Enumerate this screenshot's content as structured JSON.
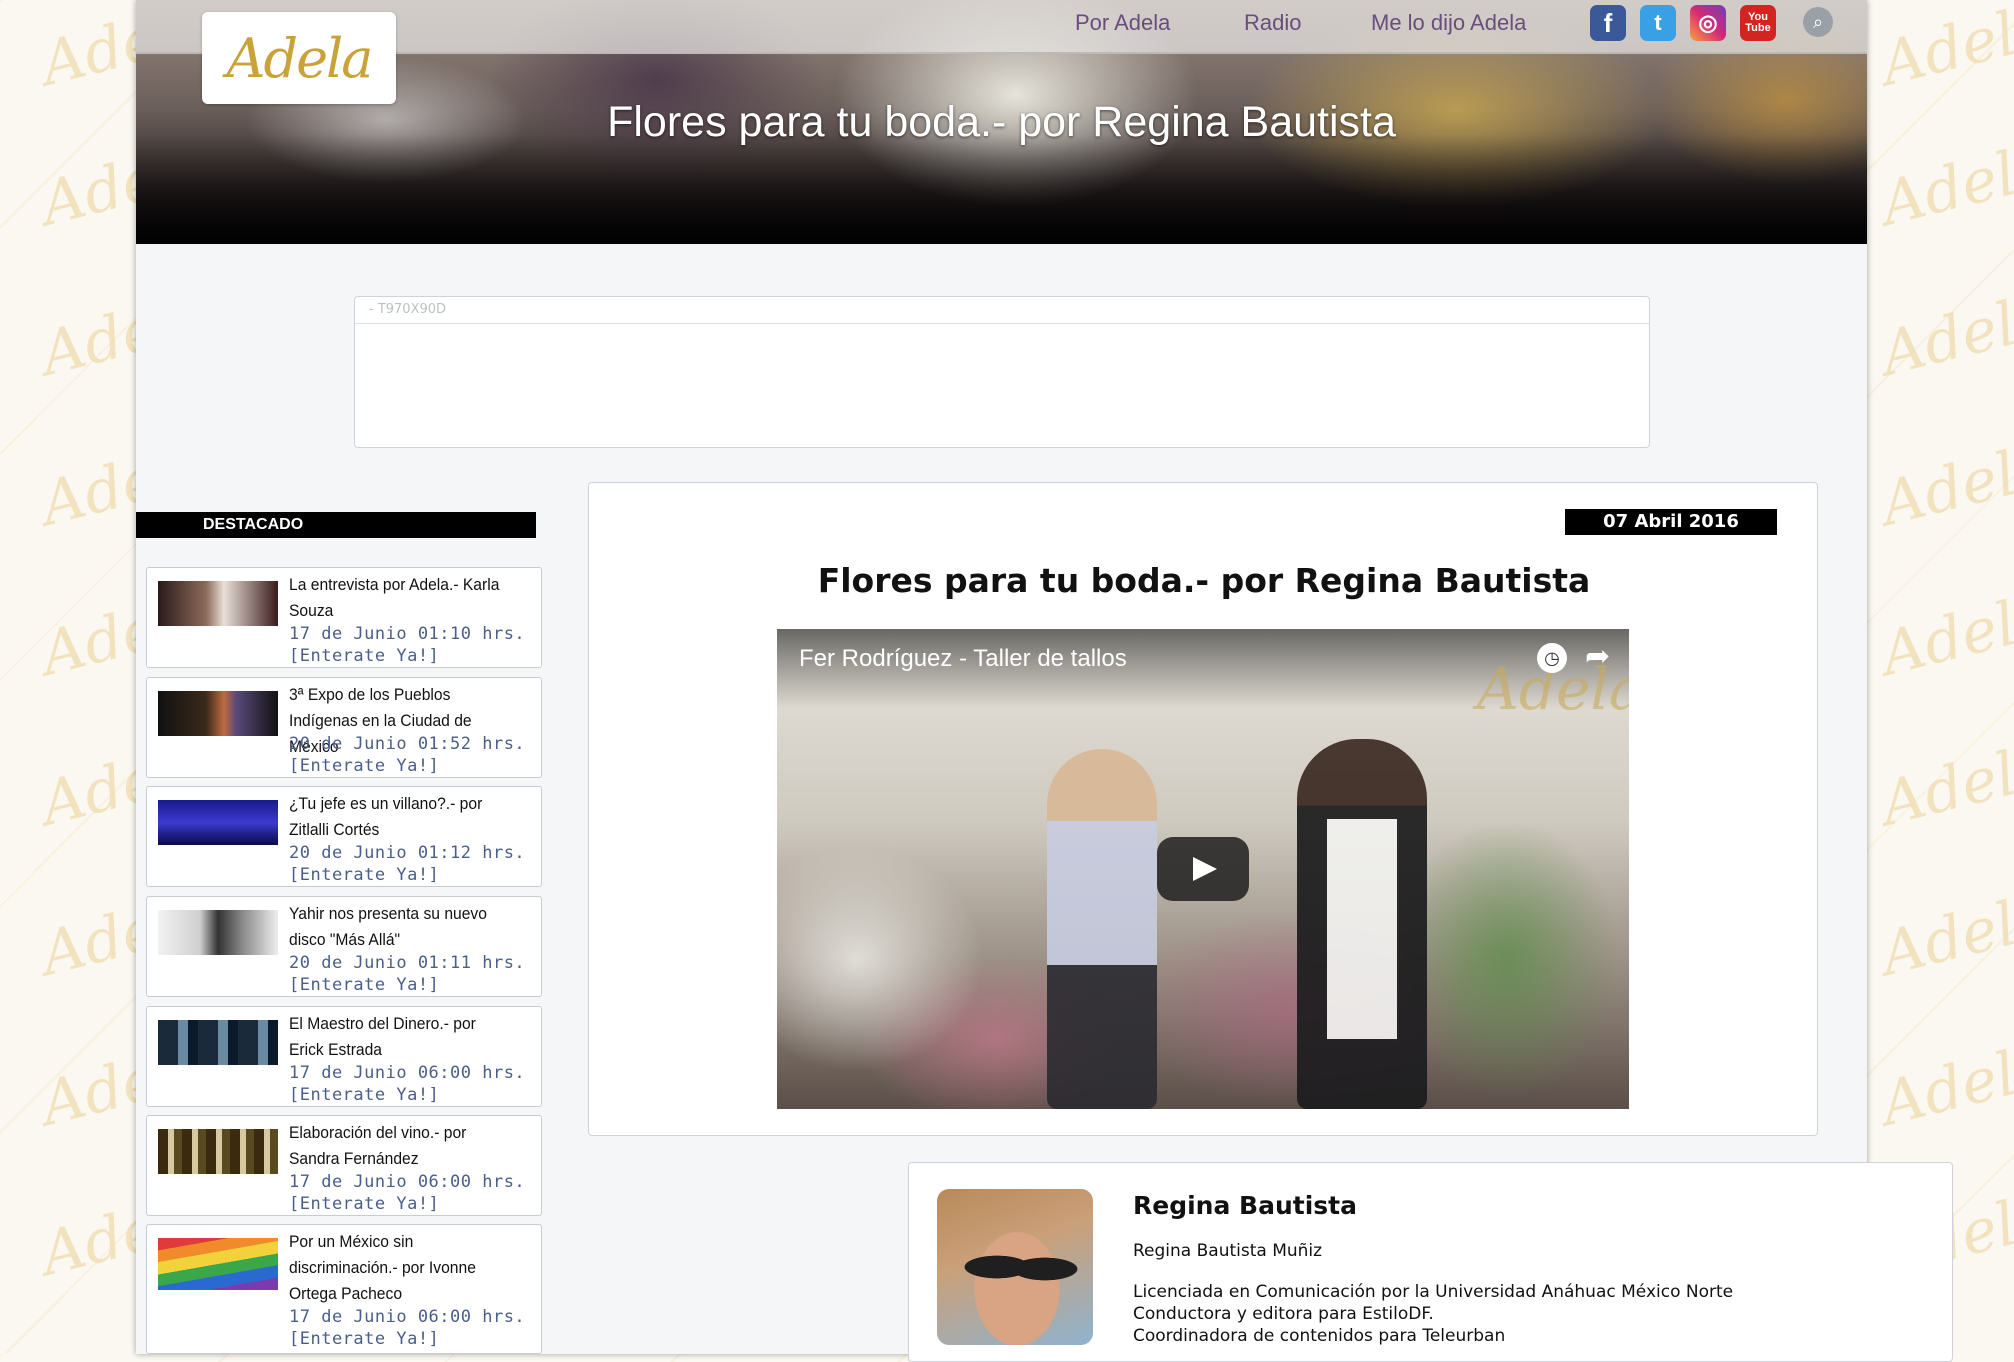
{
  "header": {
    "logo_text": "Adela",
    "nav": [
      "Por Adela",
      "Radio",
      "Me lo dijo Adela"
    ],
    "social": {
      "facebook": "f",
      "twitter": "t",
      "instagram": "◎",
      "youtube": "You Tube"
    },
    "search_icon": "search-icon",
    "hero_title": "Flores para tu boda.- por Regina Bautista"
  },
  "ad": {
    "label": "- T970X90D"
  },
  "sidebar": {
    "heading": "DESTACADO",
    "items": [
      {
        "title": "La entrevista por Adela.- Karla Souza",
        "date": "17 de Junio 01:10 hrs.",
        "more": "[Enterate Ya!]"
      },
      {
        "title": "3ª Expo de los Pueblos Indígenas en la Ciudad de México",
        "date": "20 de Junio 01:52 hrs.",
        "more": "[Enterate Ya!]"
      },
      {
        "title": "¿Tu jefe es un villano?.- por Zitlalli Cortés",
        "date": "20 de Junio 01:12 hrs.",
        "more": "[Enterate Ya!]"
      },
      {
        "title": "Yahir nos presenta su nuevo disco \"Más Allá\"",
        "date": "20 de Junio 01:11 hrs.",
        "more": "[Enterate Ya!]"
      },
      {
        "title": "El Maestro del Dinero.- por Erick Estrada",
        "date": "17 de Junio 06:00 hrs.",
        "more": "[Enterate Ya!]"
      },
      {
        "title": "Elaboración del vino.- por Sandra Fernández",
        "date": "17 de Junio 06:00 hrs.",
        "more": "[Enterate Ya!]"
      },
      {
        "title": "Por un México sin discriminación.- por Ivonne Ortega Pacheco",
        "date": "17 de Junio 06:00 hrs.",
        "more": "[Enterate Ya!]"
      }
    ]
  },
  "article": {
    "date": "07 Abril 2016",
    "title": "Flores para tu boda.- por Regina Bautista",
    "video_title": "Fer Rodríguez - Taller de tallos",
    "video_watermark": "Adela"
  },
  "author": {
    "name": "Regina Bautista",
    "full_name": "Regina Bautista Muñiz",
    "bio": "Licenciada en Comunicación por la Universidad Anáhuac México Norte\nConductora y editora para EstiloDF.\nCoordinadora de contenidos para Teleurban"
  }
}
